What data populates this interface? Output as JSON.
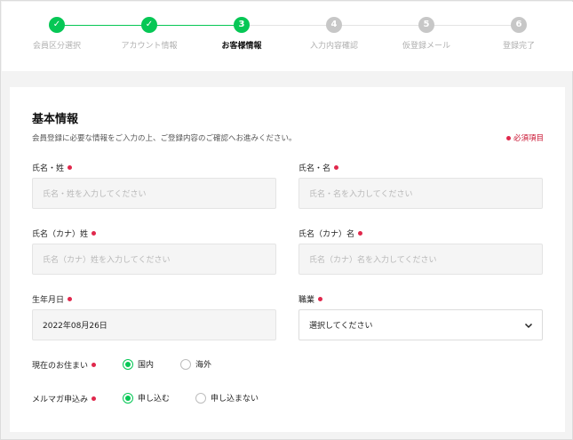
{
  "stepper": {
    "steps": [
      {
        "num": "✓",
        "label": "会員区分選択",
        "state": "done"
      },
      {
        "num": "✓",
        "label": "アカウント情報",
        "state": "done"
      },
      {
        "num": "3",
        "label": "お客様情報",
        "state": "current"
      },
      {
        "num": "4",
        "label": "入力内容確認",
        "state": "todo"
      },
      {
        "num": "5",
        "label": "仮登録メール",
        "state": "todo"
      },
      {
        "num": "6",
        "label": "登録完了",
        "state": "todo"
      }
    ]
  },
  "section": {
    "title": "基本情報",
    "description": "会員登録に必要な情報をご入力の上、ご登録内容のご確認へお進みください。",
    "required_note": "必須項目"
  },
  "fields": {
    "last_name": {
      "label": "氏名・姓",
      "placeholder": "氏名・姓を入力してください"
    },
    "first_name": {
      "label": "氏名・名",
      "placeholder": "氏名・名を入力してください"
    },
    "last_name_kana": {
      "label": "氏名（カナ）姓",
      "placeholder": "氏名（カナ）姓を入力してください"
    },
    "first_name_kana": {
      "label": "氏名（カナ）名",
      "placeholder": "氏名（カナ）名を入力してください"
    },
    "birthday": {
      "label": "生年月日",
      "value": "2022年08月26日"
    },
    "occupation": {
      "label": "職業",
      "value": "選択してください"
    },
    "residence": {
      "label": "現在のお住まい",
      "options": [
        "国内",
        "海外"
      ],
      "selected": "国内"
    },
    "newsletter": {
      "label": "メルマガ申込み",
      "options": [
        "申し込む",
        "申し込まない"
      ],
      "selected": "申し込む"
    }
  },
  "colors": {
    "accent": "#06c755",
    "required": "#e0284c"
  }
}
